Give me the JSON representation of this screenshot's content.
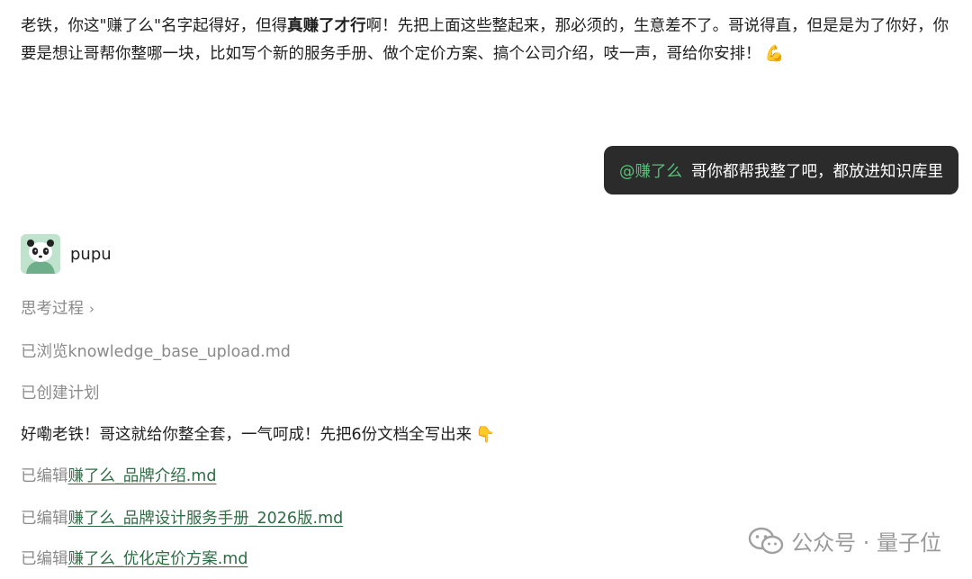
{
  "previous_message": {
    "part1": "老铁，你这\"赚了么\"名字起得好，但得",
    "bold": "真赚了才行",
    "part2": "啊！先把上面这些整起来，那必须的，生意差不了。哥说得直，但是是为了你好，你要是想让哥帮你整哪一块，比如写个新的服务手册、做个定价方案、搞个公司介绍，吱一声，哥给你安排！",
    "emoji": "💪"
  },
  "user_message": {
    "mention": "@赚了么",
    "text": "哥你都帮我整了吧，都放进知识库里"
  },
  "bot": {
    "name": "pupu",
    "avatar_icon": "panda-avatar-icon"
  },
  "steps": {
    "thinking_label": "思考过程",
    "thinking_chevron": "›",
    "browsed": "已浏览knowledge_base_upload.md",
    "plan": "已创建计划",
    "reply_text": "好嘞老铁！哥这就给你整全套，一气呵成！先把6份文档全写出来",
    "reply_emoji": "👇",
    "edits": [
      {
        "prefix": "已编辑",
        "file": "赚了么_品牌介绍.md"
      },
      {
        "prefix": "已编辑",
        "file": "赚了么_品牌设计服务手册_2026版.md"
      },
      {
        "prefix": "已编辑",
        "file": "赚了么_优化定价方案.md"
      }
    ]
  },
  "watermark": {
    "text": "公众号 · 量子位",
    "icon": "wechat-icon"
  },
  "colors": {
    "bubble_bg": "#2b2b2b",
    "mention": "#56c27a",
    "link": "#2f6b45",
    "muted": "#8a8a8a"
  }
}
